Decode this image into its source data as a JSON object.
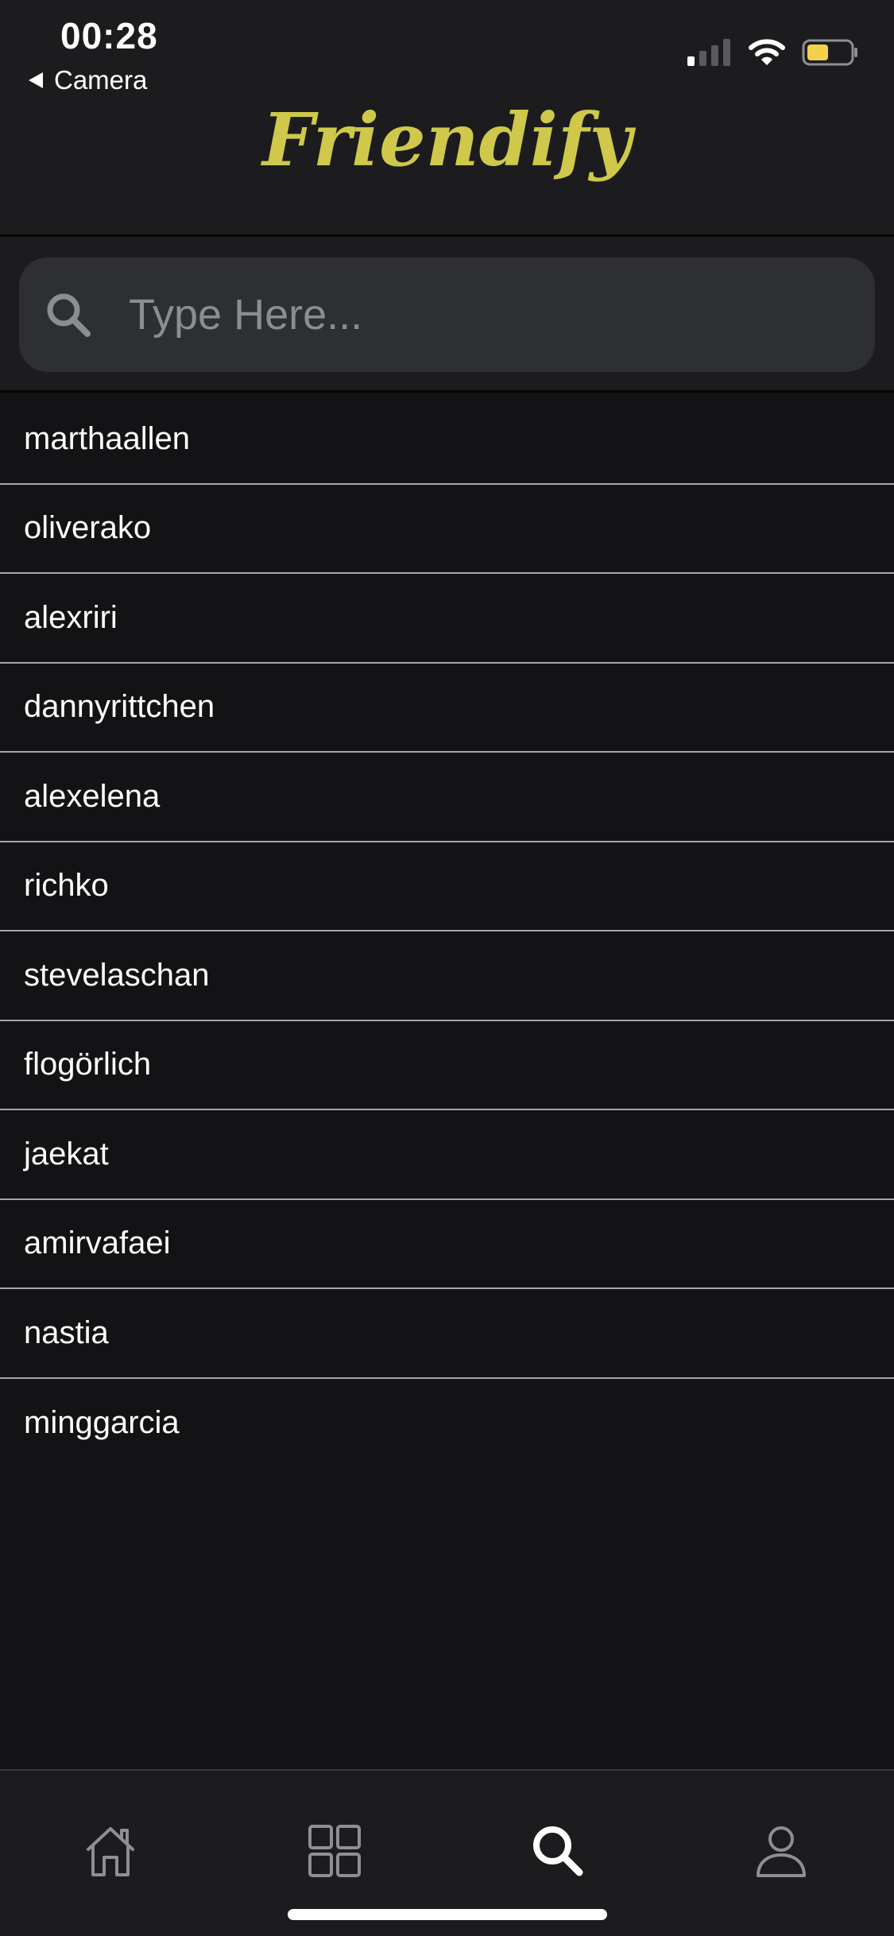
{
  "status_bar": {
    "time": "00:28",
    "back_label": "Camera"
  },
  "header": {
    "title": "Friendify",
    "title_color": "#cfc84a"
  },
  "search": {
    "placeholder": "Type Here...",
    "value": ""
  },
  "users": [
    "marthaallen",
    "oliverako",
    "alexriri",
    "dannyrittchen",
    "alexelena",
    "richko",
    "stevelaschan",
    "flogörlich",
    "jaekat",
    "amirvafaei",
    "nastia",
    "minggarcia"
  ],
  "tabs": [
    {
      "icon": "home-icon",
      "active": false
    },
    {
      "icon": "grid-icon",
      "active": false
    },
    {
      "icon": "search-icon",
      "active": true
    },
    {
      "icon": "profile-icon",
      "active": false
    }
  ],
  "colors": {
    "background": "#131315",
    "header": "#1c1c1e",
    "search_field": "#2d2f33",
    "battery_fill": "#f2d24a",
    "divider": "#a7a7aa"
  }
}
